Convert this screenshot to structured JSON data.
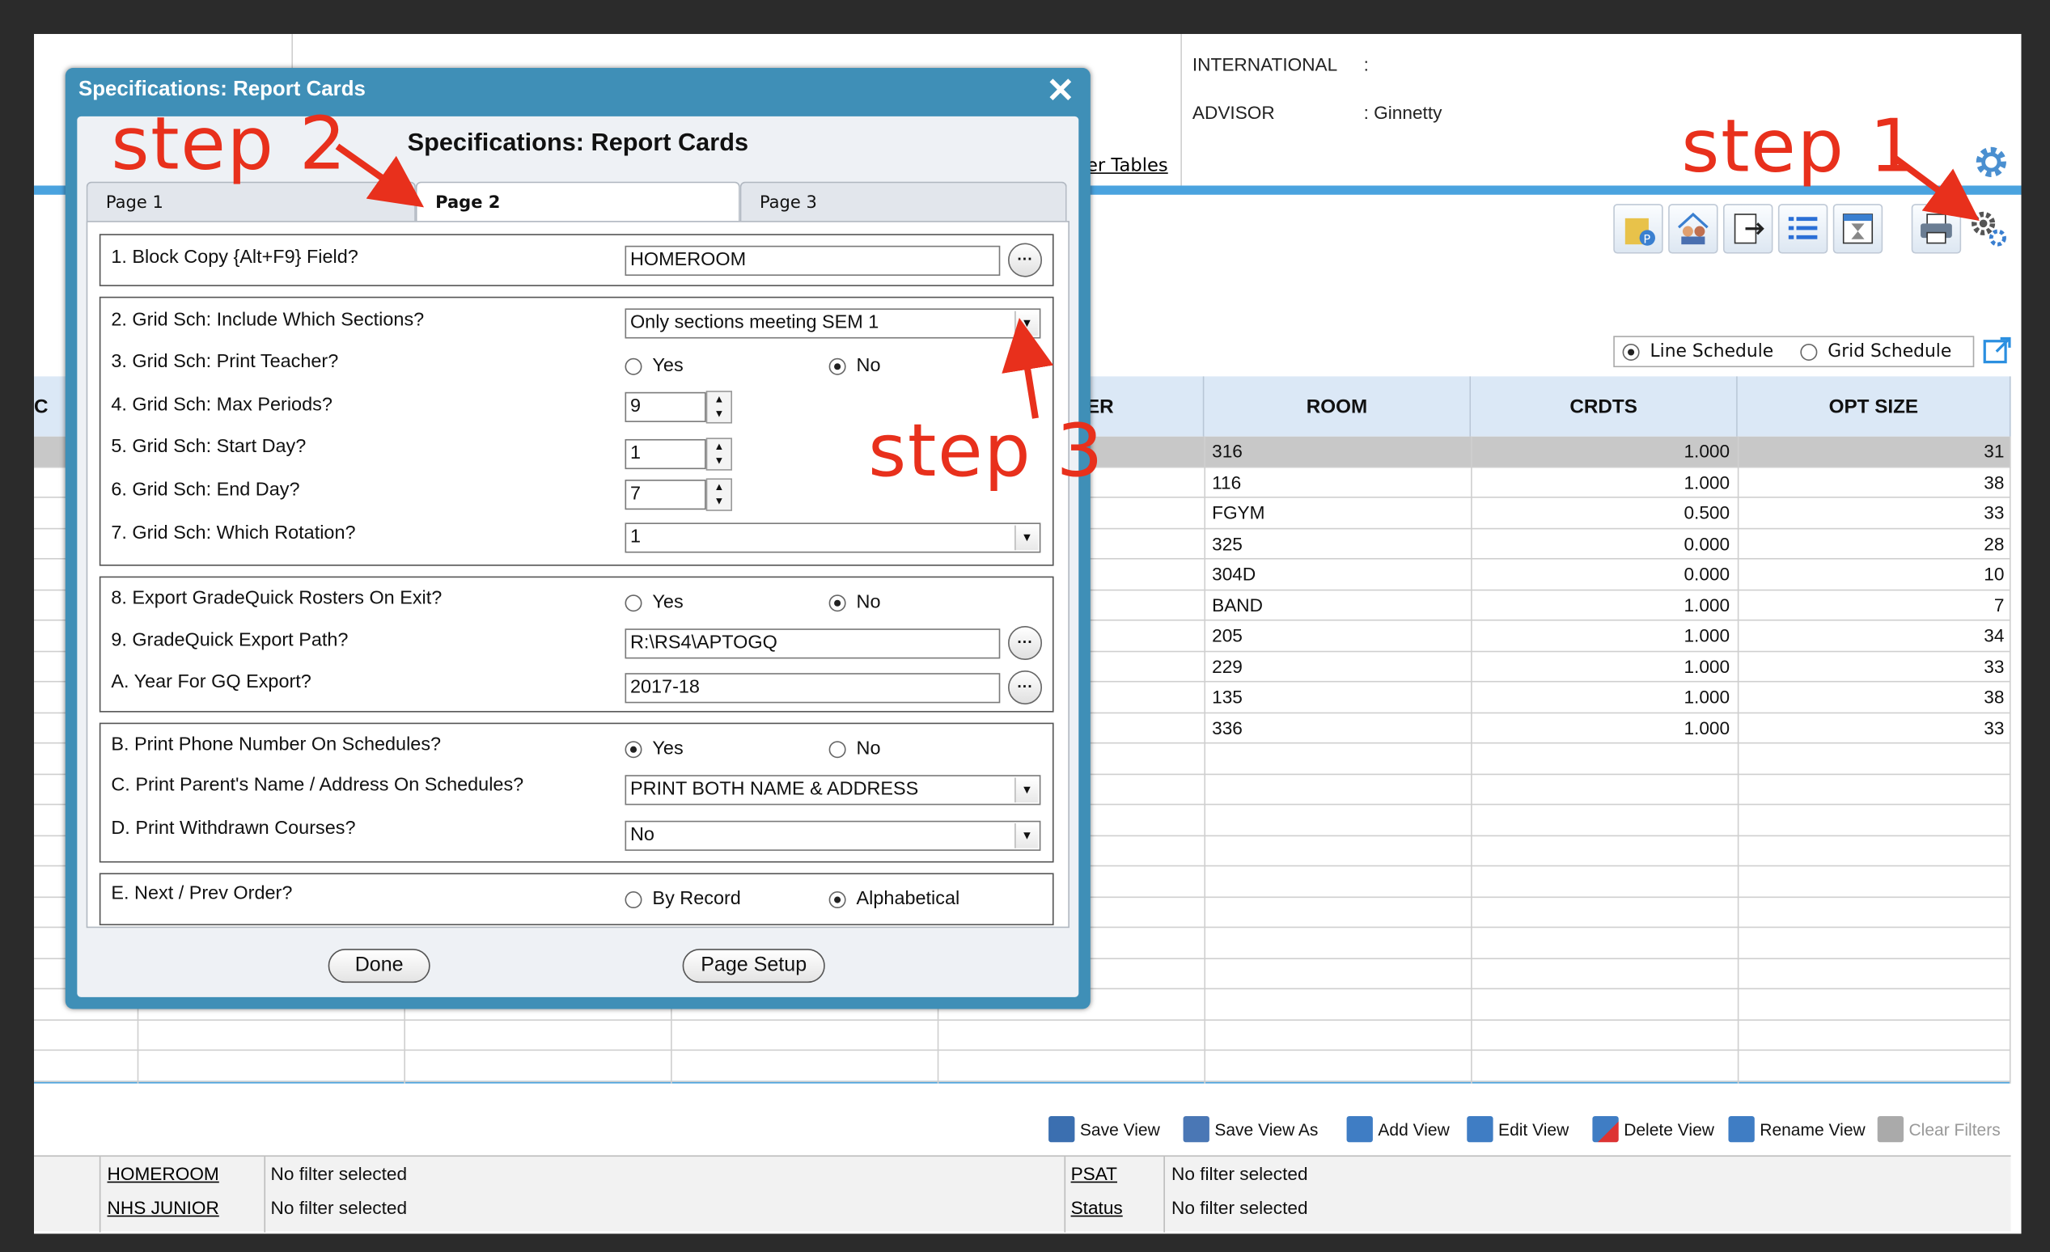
{
  "header": {
    "international_label": "INTERNATIONAL",
    "international_value": ":",
    "advisor_label": "ADVISOR",
    "advisor_value": ": Ginnetty",
    "tables_link": "er Tables"
  },
  "view_mode": {
    "line_schedule": "Line Schedule",
    "grid_schedule": "Grid Schedule",
    "selected": "Line Schedule"
  },
  "grid": {
    "columns": [
      "C",
      "ER",
      "ROOM",
      "CRDTS",
      "OPT SIZE"
    ],
    "rows": [
      {
        "room": "316",
        "crdts": "1.000",
        "opt": "31"
      },
      {
        "room": "116",
        "crdts": "1.000",
        "opt": "38"
      },
      {
        "room": "FGYM",
        "crdts": "0.500",
        "opt": "33"
      },
      {
        "room": "325",
        "crdts": "0.000",
        "opt": "28"
      },
      {
        "room": "304D",
        "crdts": "0.000",
        "opt": "10"
      },
      {
        "room": "BAND",
        "crdts": "1.000",
        "opt": "7"
      },
      {
        "room": "205",
        "crdts": "1.000",
        "opt": "34"
      },
      {
        "room": "229",
        "crdts": "1.000",
        "opt": "33"
      },
      {
        "room": "135",
        "crdts": "1.000",
        "opt": "38"
      },
      {
        "room": "336",
        "crdts": "1.000",
        "opt": "33"
      }
    ]
  },
  "view_actions": [
    "Save View",
    "Save View As",
    "Add View",
    "Edit View",
    "Delete View",
    "Rename View",
    "Clear Filters"
  ],
  "filters": [
    {
      "name": "HOMEROOM",
      "value": "No filter selected"
    },
    {
      "name": "NHS JUNIOR",
      "value": "No filter selected"
    },
    {
      "name": "PSAT",
      "value": "No filter selected"
    },
    {
      "name": "Status",
      "value": "No filter selected"
    }
  ],
  "dialog": {
    "title": "Specifications: Report Cards",
    "heading": "Specifications: Report Cards",
    "tabs": [
      "Page 1",
      "Page 2",
      "Page 3"
    ],
    "active_tab": "Page 2",
    "fields": {
      "f1_label": "1. Block Copy {Alt+F9} Field?",
      "f1_value": "HOMEROOM",
      "f2_label": "2. Grid Sch: Include Which Sections?",
      "f2_value": "Only sections meeting SEM 1",
      "f3_label": "3. Grid Sch: Print Teacher?",
      "f4_label": "4. Grid Sch: Max Periods?",
      "f4_value": "9",
      "f5_label": "5. Grid Sch: Start Day?",
      "f5_value": "1",
      "f6_label": "6. Grid Sch: End Day?",
      "f6_value": "7",
      "f7_label": "7. Grid Sch: Which Rotation?",
      "f7_value": "1",
      "f8_label": "8. Export GradeQuick Rosters On Exit?",
      "f9_label": "9. GradeQuick Export Path?",
      "f9_value": "R:\\RS4\\APTOGQ",
      "fA_label": "A. Year For GQ Export?",
      "fA_value": "2017-18",
      "fB_label": "B. Print Phone Number On Schedules?",
      "fC_label": "C. Print Parent's Name / Address On Schedules?",
      "fC_value": "PRINT BOTH NAME & ADDRESS",
      "fD_label": "D. Print Withdrawn Courses?",
      "fD_value": "No",
      "fE_label": "E. Next / Prev Order?"
    },
    "radio_labels": {
      "yes": "Yes",
      "no": "No",
      "by_record": "By Record",
      "alphabetical": "Alphabetical"
    },
    "radio_state": {
      "f3": "No",
      "f8": "No",
      "fB": "Yes",
      "fE": "Alphabetical"
    },
    "buttons": {
      "done": "Done",
      "page_setup": "Page Setup"
    }
  },
  "annotations": {
    "step1": "step 1",
    "step2": "step 2",
    "step3": "step 3"
  },
  "colors": {
    "accent": "#4aa3df",
    "dialog_frame": "#3f8fb7",
    "annotation": "#e8301c"
  }
}
